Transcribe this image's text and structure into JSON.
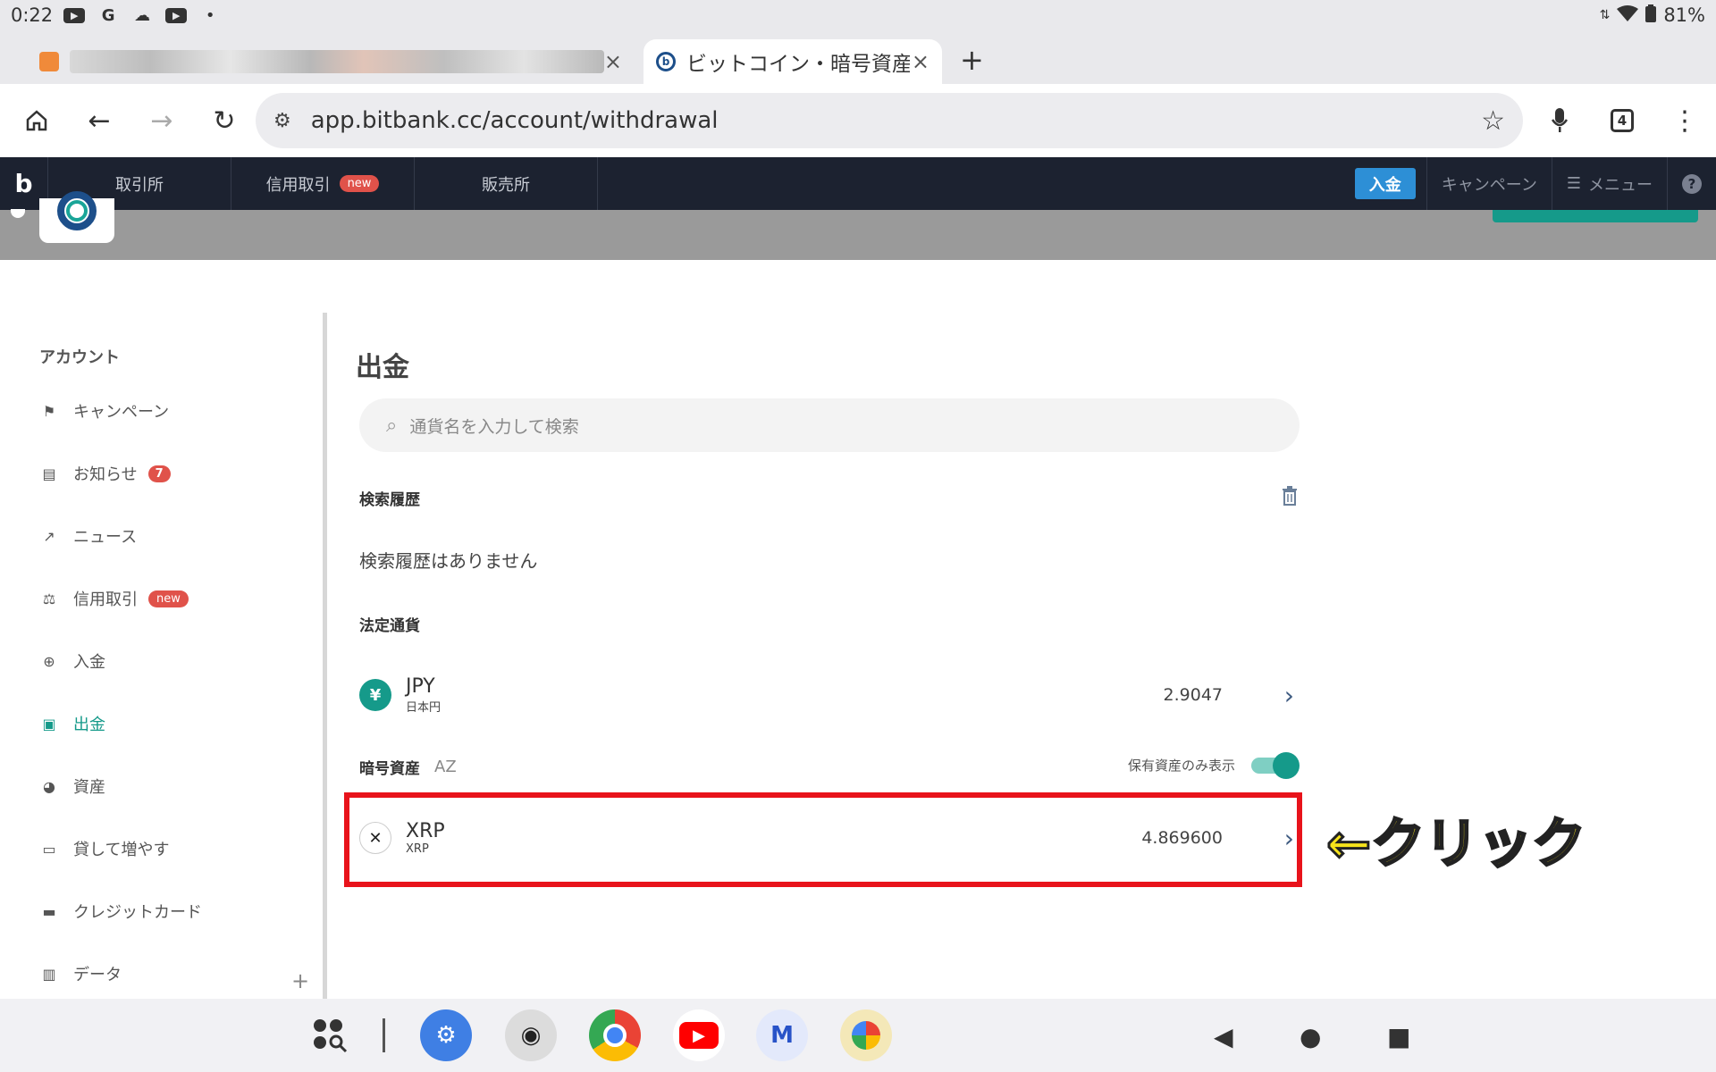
{
  "status_bar": {
    "time": "0:22",
    "google": "G",
    "battery": "81%"
  },
  "tabs": [
    {
      "label": "",
      "close": "×"
    },
    {
      "label": "ビットコイン・暗号資産",
      "close": "×"
    }
  ],
  "new_tab": "+",
  "address_bar": {
    "url": "app.bitbank.cc/account/withdrawal",
    "tab_count": "4"
  },
  "site_nav": {
    "logo": "b",
    "items": [
      {
        "label": "取引所"
      },
      {
        "label": "信用取引",
        "badge": "new"
      },
      {
        "label": "販売所"
      }
    ],
    "deposit_button": "入金",
    "campaign": "キャンペーン",
    "menu": "メニュー",
    "help": "?"
  },
  "sidebar": {
    "title": "アカウント",
    "items": [
      {
        "label": "キャンペーン",
        "icon": "flag-icon"
      },
      {
        "label": "お知らせ",
        "icon": "message-icon",
        "badge": "7"
      },
      {
        "label": "ニュース",
        "icon": "news-icon"
      },
      {
        "label": "信用取引",
        "icon": "scale-icon",
        "badge": "new"
      },
      {
        "label": "入金",
        "icon": "plus-circle-icon"
      },
      {
        "label": "出金",
        "icon": "wallet-icon",
        "active": true
      },
      {
        "label": "資産",
        "icon": "pie-chart-icon"
      },
      {
        "label": "貸して増やす",
        "icon": "cash-icon"
      },
      {
        "label": "クレジットカード",
        "icon": "credit-card-icon"
      },
      {
        "label": "データ",
        "icon": "clipboard-icon"
      }
    ],
    "expand": "+"
  },
  "main": {
    "title": "出金",
    "search_placeholder": "通貨名を入力して検索",
    "history_title": "検索履歴",
    "history_empty": "検索履歴はありません",
    "fiat_title": "法定通貨",
    "fiat": {
      "symbol": "JPY",
      "name": "日本円",
      "icon": "¥",
      "amount": "2.9047"
    },
    "crypto_title": "暗号資産",
    "sort_icon": "AZ",
    "holdings_only_label": "保有資産のみ表示",
    "holdings_only_enabled": true,
    "crypto": [
      {
        "symbol": "XRP",
        "name": "XRP",
        "icon": "✕",
        "amount": "4.869600"
      }
    ]
  },
  "annotation": {
    "callout": "←クリック",
    "color": "#e8131b"
  },
  "colors": {
    "accent": "#159a8a",
    "header_bg": "#1c2230",
    "badge": "#e0524a",
    "deposit": "#2d8fd6"
  }
}
